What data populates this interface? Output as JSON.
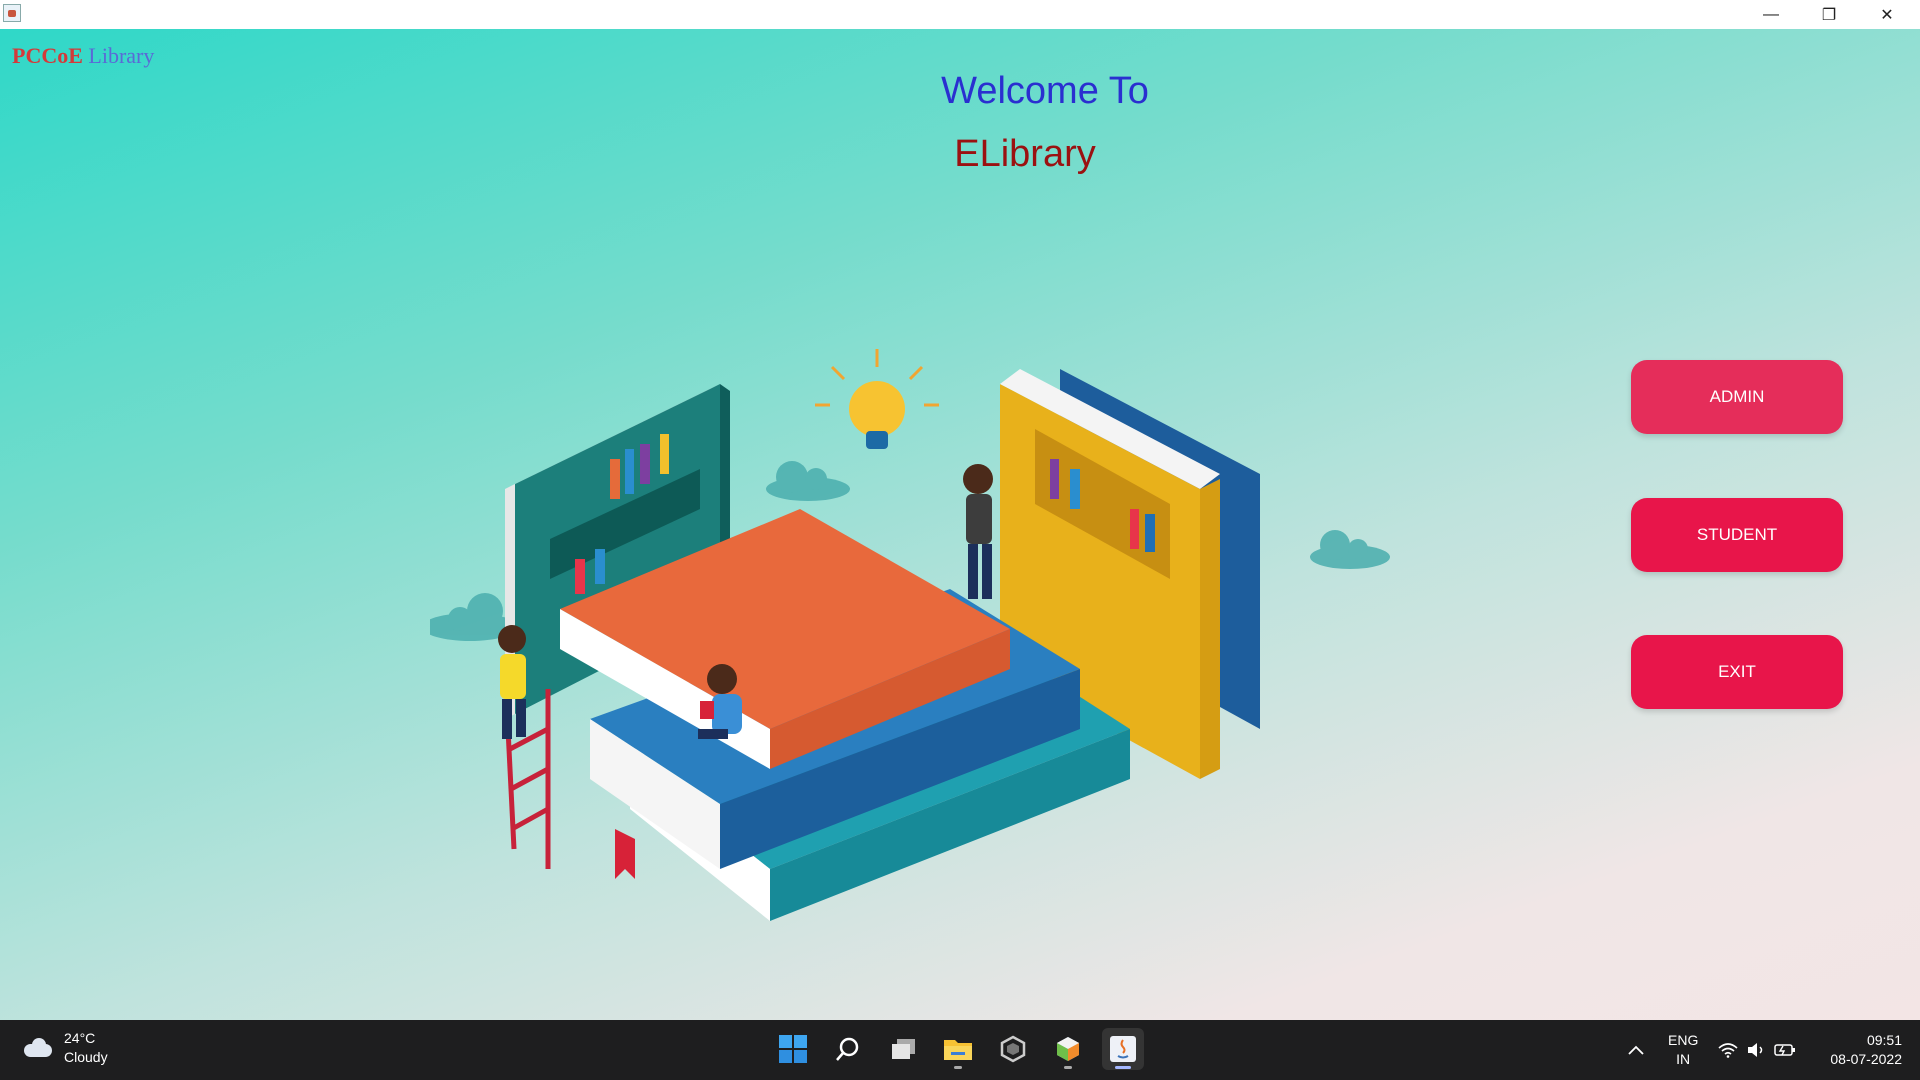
{
  "window": {
    "controls": {
      "minimize": "—",
      "maximize": "❐",
      "close": "✕"
    }
  },
  "app": {
    "brand_part1": "PCCoE",
    "brand_part2": "Library",
    "welcome": "Welcome To",
    "subtitle": "ELibrary",
    "buttons": {
      "admin": "ADMIN",
      "student": "STUDENT",
      "exit": "EXIT"
    },
    "colors": {
      "admin": "#e52d5a",
      "student": "#e8154a",
      "exit": "#e8154a",
      "welcome": "#2a2fd0",
      "subtitle": "#9b1111"
    }
  },
  "taskbar": {
    "weather_temp": "24°C",
    "weather_desc": "Cloudy",
    "icons": [
      "start-icon",
      "search-icon",
      "task-view-icon",
      "file-explorer-icon",
      "unity-icon",
      "netbeans-icon",
      "java-icon"
    ],
    "lang_line1": "ENG",
    "lang_line2": "IN",
    "time": "09:51",
    "date": "08-07-2022"
  }
}
